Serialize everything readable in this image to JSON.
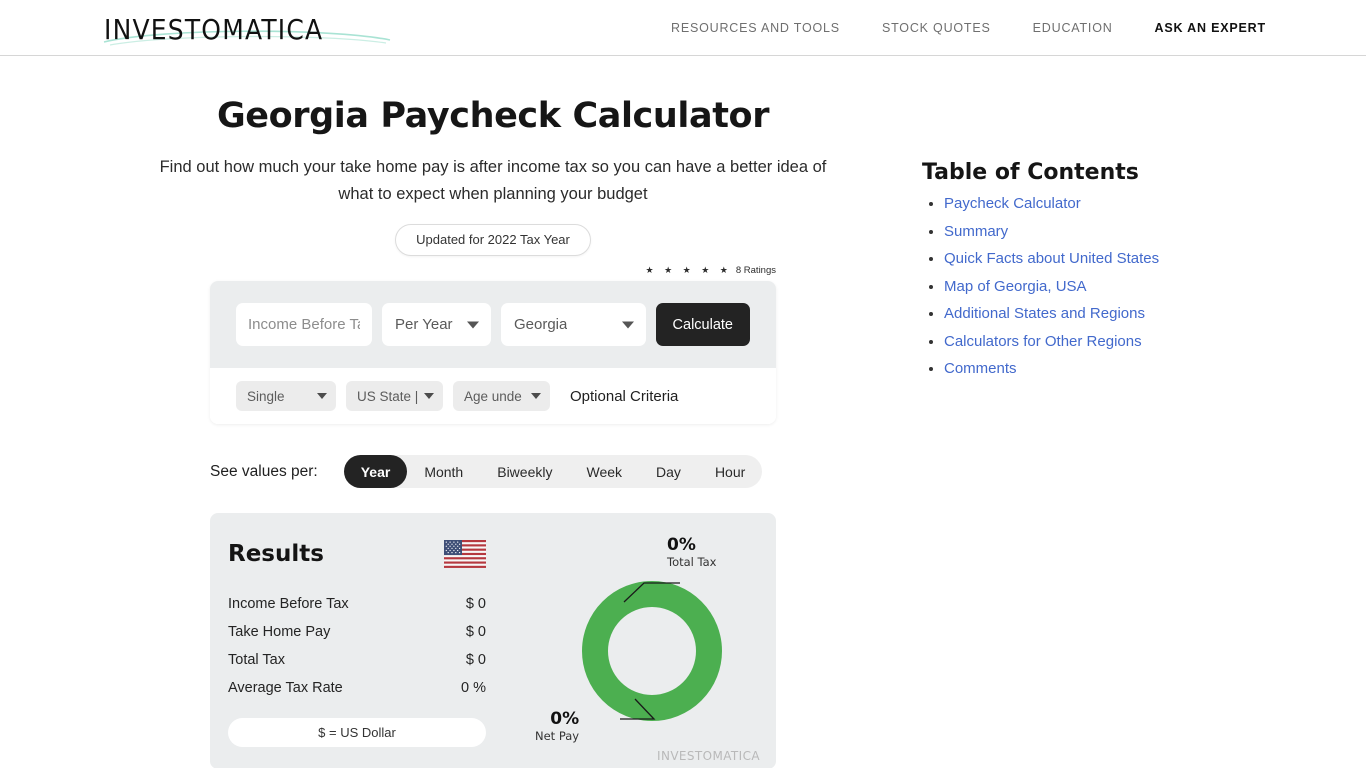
{
  "header": {
    "logo_text": "INVESTOMATICA",
    "nav": [
      {
        "label": "RESOURCES AND TOOLS",
        "active": false
      },
      {
        "label": "STOCK QUOTES",
        "active": false
      },
      {
        "label": "EDUCATION",
        "active": false
      },
      {
        "label": "ASK AN EXPERT",
        "active": true
      }
    ]
  },
  "hero": {
    "title": "Georgia Paycheck Calculator",
    "subtitle": "Find out how much your take home pay is after income tax so you can have a better idea of what to expect when planning your budget",
    "update_badge": "Updated for 2022 Tax Year",
    "stars": "★ ★ ★ ★ ★",
    "ratings_count": "8 Ratings"
  },
  "calculator": {
    "income_placeholder": "Income Before Tax",
    "income_value": "",
    "period_select": "Per Year",
    "region_select": "Georgia",
    "calculate_label": "Calculate",
    "filing_status": "Single",
    "state_select": "US State |",
    "age_select": "Age unde",
    "optional_label": "Optional Criteria"
  },
  "period_switch": {
    "label": "See values per:",
    "options": [
      {
        "label": "Year",
        "active": true
      },
      {
        "label": "Month",
        "active": false
      },
      {
        "label": "Biweekly",
        "active": false
      },
      {
        "label": "Week",
        "active": false
      },
      {
        "label": "Day",
        "active": false
      },
      {
        "label": "Hour",
        "active": false
      }
    ]
  },
  "results": {
    "title": "Results",
    "flag_icon": "us-flag-icon",
    "rows": [
      {
        "label": "Income Before Tax",
        "value": "$ 0"
      },
      {
        "label": "Take Home Pay",
        "value": "$ 0"
      },
      {
        "label": "Total Tax",
        "value": "$ 0"
      },
      {
        "label": "Average Tax Rate",
        "value": "0 %"
      }
    ],
    "currency_note": "$ = US Dollar",
    "watermark": "INVESTOMATICA"
  },
  "chart_data": {
    "type": "pie",
    "title": "",
    "categories": [
      "Total Tax",
      "Net Pay"
    ],
    "values": [
      0,
      0
    ],
    "labels": [
      "0%",
      "0%"
    ],
    "colors": [
      "#e8eaeb",
      "#4caf50"
    ],
    "donut": true,
    "legend": "callout-labels"
  },
  "toc": {
    "title": "Table of Contents",
    "items": [
      {
        "label": "Paycheck Calculator"
      },
      {
        "label": "Summary"
      },
      {
        "label": "Quick Facts about United States"
      },
      {
        "label": "Map of Georgia, USA"
      },
      {
        "label": "Additional States and Regions"
      },
      {
        "label": "Calculators for Other Regions"
      },
      {
        "label": "Comments"
      }
    ]
  },
  "colors": {
    "accent_green": "#4caf50",
    "link_blue": "#4269cc",
    "dark": "#232323",
    "card_gray": "#ebedee"
  }
}
